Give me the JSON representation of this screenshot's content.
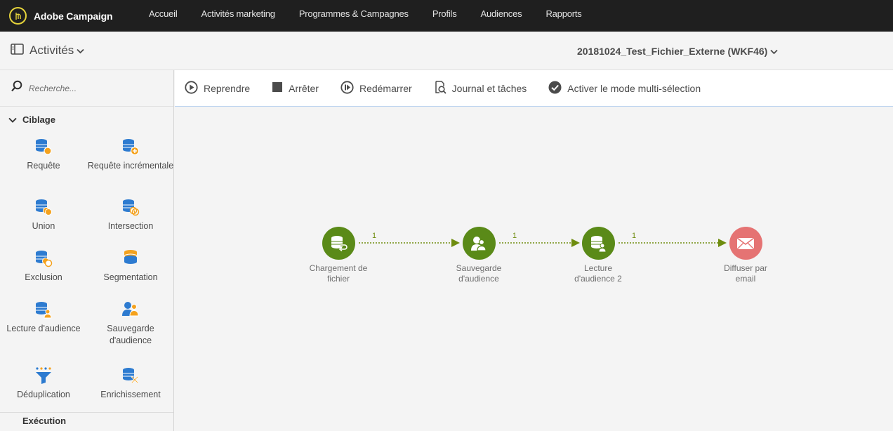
{
  "topnav": {
    "brand": "Adobe Campaign",
    "items": [
      {
        "label": "Accueil"
      },
      {
        "label": "Activités marketing"
      },
      {
        "label": "Programmes & Campagnes"
      },
      {
        "label": "Profils"
      },
      {
        "label": "Audiences"
      },
      {
        "label": "Rapports"
      }
    ]
  },
  "subheader": {
    "activities_label": "Activités",
    "workflow_title": "20181024_Test_Fichier_Externe (WKF46)"
  },
  "sidebar": {
    "search_placeholder": "Recherche...",
    "section_label": "Ciblage",
    "next_section_label": "Exécution",
    "tiles": [
      {
        "label": "Requête",
        "icon": "query-icon"
      },
      {
        "label": "Requête incrémentale",
        "icon": "incremental-query-icon"
      },
      {
        "label": "Union",
        "icon": "union-icon"
      },
      {
        "label": "Intersection",
        "icon": "intersection-icon"
      },
      {
        "label": "Exclusion",
        "icon": "exclusion-icon"
      },
      {
        "label": "Segmentation",
        "icon": "segmentation-icon"
      },
      {
        "label": "Lecture d'audience",
        "icon": "read-audience-icon"
      },
      {
        "label": "Sauvegarde d'audience",
        "icon": "save-audience-icon"
      },
      {
        "label": "Déduplication",
        "icon": "deduplication-icon"
      },
      {
        "label": "Enrichissement",
        "icon": "enrichment-icon"
      }
    ]
  },
  "toolbar": {
    "resume": "Reprendre",
    "stop": "Arrêter",
    "restart": "Redémarrer",
    "journal": "Journal et tâches",
    "multiselect": "Activer le mode multi-sélection"
  },
  "workflow": {
    "nodes": [
      {
        "label_line1": "Chargement de",
        "label_line2": "fichier",
        "icon": "file-load-icon"
      },
      {
        "label_line1": "Sauvegarde",
        "label_line2": "d'audience",
        "icon": "save-audience-icon"
      },
      {
        "label_line1": "Lecture",
        "label_line2": "d'audience 2",
        "icon": "read-audience-icon"
      },
      {
        "label_line1": "Diffuser par",
        "label_line2": "email",
        "icon": "email-icon"
      }
    ],
    "edges": [
      {
        "count": "1"
      },
      {
        "count": "1"
      },
      {
        "count": "1"
      }
    ]
  },
  "colors": {
    "topbar": "#1f1f1f",
    "node_green": "#5a8a18",
    "node_red": "#e57373",
    "icon_blue": "#2d7bd0",
    "icon_orange": "#f4a21e",
    "edge_green": "#6e8c0e"
  }
}
